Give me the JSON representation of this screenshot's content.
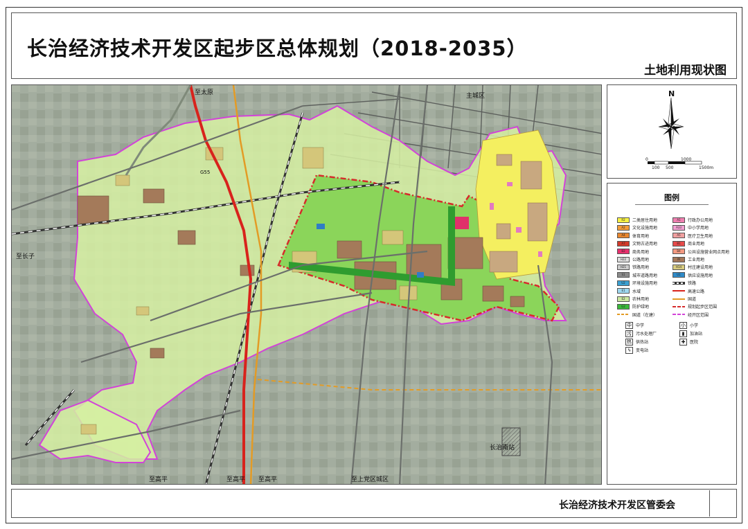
{
  "header": {
    "title": "长治经济技术开发区起步区总体规划（2018-2035）",
    "subtitle": "土地利用现状图"
  },
  "map": {
    "labels": {
      "to_taiyuan": "至太原",
      "main_city": "主城区",
      "to_changzi": "至长子",
      "to_gaoping_1": "至高平",
      "to_gaoping_2": "至高平",
      "to_gaoping_3": "至高平",
      "to_shangdang": "至上党区城区",
      "changzhi_south_station": "长治南站",
      "g55": "G55"
    }
  },
  "compass": {
    "north": "N",
    "scale_ticks": [
      "0",
      "100",
      "500",
      "1000",
      "1500m"
    ]
  },
  "legend": {
    "title": "图例",
    "items": [
      {
        "code": "R2",
        "label": "二类居住用地",
        "color": "#f7f244"
      },
      {
        "code": "A1",
        "label": "行政办公用地",
        "color": "#ef7fb0"
      },
      {
        "code": "A2",
        "label": "文化设施用地",
        "color": "#f29c3a"
      },
      {
        "code": "A33",
        "label": "中小学用地",
        "color": "#f2a0d2"
      },
      {
        "code": "A4",
        "label": "体育用地",
        "color": "#e8862e"
      },
      {
        "code": "A5",
        "label": "医疗卫生用地",
        "color": "#f0a0a0"
      },
      {
        "code": "A7",
        "label": "文物古迹用地",
        "color": "#d23a2a"
      },
      {
        "code": "B1",
        "label": "商业用地",
        "color": "#e64a4a"
      },
      {
        "code": "B2",
        "label": "商务用地",
        "color": "#e8306e"
      },
      {
        "code": "B4",
        "label": "公共设施营业网点用地",
        "color": "#f39a82"
      },
      {
        "code": "H22",
        "label": "公路用地",
        "color": "#dedede"
      },
      {
        "code": "M",
        "label": "工业用地",
        "color": "#a4785a"
      },
      {
        "code": "H21",
        "label": "铁路用地",
        "color": "#cccccc"
      },
      {
        "code": "H14",
        "label": "村庄建设用地",
        "color": "#d8cc80"
      },
      {
        "code": "S1",
        "label": "城市道路用地",
        "color": "#8a8a8a"
      },
      {
        "code": "U1",
        "label": "供应设施用地",
        "color": "#2f8ac8"
      },
      {
        "code": "U2",
        "label": "环境设施用地",
        "color": "#3aa0d2"
      },
      {
        "code": "",
        "label": "铁路",
        "color": ""
      },
      {
        "code": "E1",
        "label": "水域",
        "color": "#9ed8f0"
      },
      {
        "code": "",
        "label": "高速公路",
        "color": ""
      },
      {
        "code": "E2",
        "label": "农林用地",
        "color": "#cce8a0"
      },
      {
        "code": "",
        "label": "国道",
        "color": ""
      },
      {
        "code": "G2",
        "label": "防护绿地",
        "color": "#3ab83a"
      },
      {
        "code": "",
        "label": "规划起步区范围",
        "color": ""
      },
      {
        "code": "",
        "label": "国道（在建）",
        "color": ""
      },
      {
        "code": "",
        "label": "经开区范围",
        "color": ""
      }
    ],
    "symbols": [
      {
        "glyph": "中",
        "label": "中学"
      },
      {
        "glyph": "小",
        "label": "小学"
      },
      {
        "glyph": "污",
        "label": "污水处理厂"
      },
      {
        "glyph": "▮",
        "label": "加油站"
      },
      {
        "glyph": "热",
        "label": "供热站"
      },
      {
        "glyph": "✚",
        "label": "医院"
      },
      {
        "glyph": "ϟ",
        "label": "变电站"
      }
    ]
  },
  "footer": {
    "org": "长治经济技术开发区管委会"
  }
}
